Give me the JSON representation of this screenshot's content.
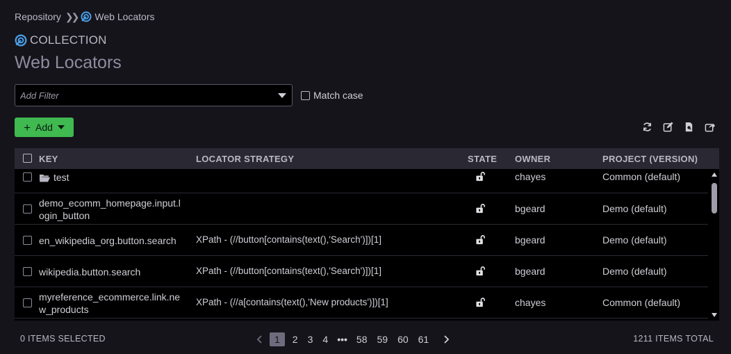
{
  "breadcrumb": {
    "root": "Repository",
    "current": "Web Locators"
  },
  "header": {
    "collection_label": "COLLECTION",
    "title": "Web Locators"
  },
  "filter": {
    "placeholder": "Add Filter",
    "match_case_label": "Match case"
  },
  "toolbar": {
    "add_label": "Add",
    "icons": [
      "refresh-icon",
      "edit-icon",
      "document-search-icon",
      "export-icon"
    ]
  },
  "table": {
    "columns": {
      "key": "KEY",
      "strategy": "LOCATOR STRATEGY",
      "state": "STATE",
      "owner": "OWNER",
      "project": "PROJECT (VERSION)"
    },
    "rows": [
      {
        "key": "test",
        "strategy": "",
        "owner": "chayes",
        "project": "Common (default)",
        "folder": true
      },
      {
        "key": "demo_ecomm_homepage.input.l ogin_button",
        "strategy": "",
        "owner": "bgeard",
        "project": "Demo (default)"
      },
      {
        "key": "en_wikipedia_org.button.search",
        "strategy": "XPath - (//button[contains(text(),'Search')])[1]",
        "owner": "bgeard",
        "project": "Demo (default)"
      },
      {
        "key": "wikipedia.button.search",
        "strategy": "XPath - (//button[contains(text(),'Search')])[1]",
        "owner": "bgeard",
        "project": "Demo (default)"
      },
      {
        "key": "myreference_ecommerce.link.ne w_products",
        "strategy": "XPath - (//a[contains(text(),'New products')])[1]",
        "owner": "chayes",
        "project": "Common (default)"
      }
    ]
  },
  "footer": {
    "selected": "0 ITEMS SELECTED",
    "total": "1211 ITEMS TOTAL",
    "pages": [
      "1",
      "2",
      "3",
      "4",
      "58",
      "59",
      "60",
      "61"
    ],
    "ellipsis": "•••",
    "current_page": "1"
  },
  "colors": {
    "accent_green": "#3fb950",
    "background": "#15141b",
    "table_bg": "#000000",
    "header_bg": "#2a2833"
  }
}
